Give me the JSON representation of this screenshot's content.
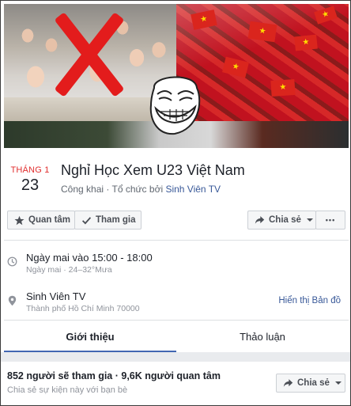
{
  "event": {
    "month": "THÁNG 1",
    "day": "23",
    "title": "Nghỉ Học Xem U23 Việt Nam",
    "privacy": "Công khai",
    "organizer_prefix": "Tổ chức bởi",
    "organizer": "Sinh Viên TV"
  },
  "actions": {
    "interested_label": "Quan tâm",
    "going_label": "Tham gia",
    "share_label": "Chia sẻ",
    "more_label": "•••"
  },
  "details": {
    "time": "Ngày mai vào 15:00 - 18:00",
    "weather": "Ngày mai · 24–32°Mưa",
    "location_name": "Sinh Viên TV",
    "location_city": "Thành phố Hồ Chí Minh 70000",
    "map_link": "Hiển thị Bản đồ"
  },
  "tabs": [
    {
      "label": "Giới thiệu",
      "active": true
    },
    {
      "label": "Thảo luận",
      "active": false
    }
  ],
  "attendance": {
    "summary": "852 người sẽ tham gia · 9,6K người quan tâm",
    "share_prompt": "Chia sẻ sự kiện này với bạn bè",
    "share_label": "Chia sẻ"
  },
  "colors": {
    "accent": "#4267b2",
    "link": "#385898",
    "month_red": "#e12e2e"
  },
  "icons": [
    "star-icon",
    "check-icon",
    "share-arrow-icon",
    "caret-down-icon",
    "more-dots-icon",
    "clock-icon",
    "location-pin-icon"
  ]
}
